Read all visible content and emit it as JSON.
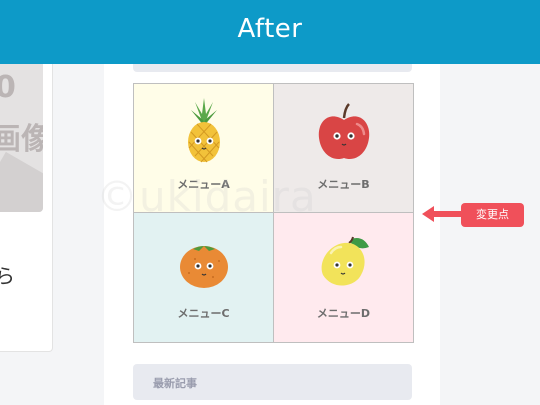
{
  "header": {
    "title": "After"
  },
  "left_column": {
    "thumb_zero": "0",
    "thumb_text": "画像",
    "partial_text": "ら"
  },
  "menu": {
    "items": [
      {
        "label": "メニューA",
        "icon": "pineapple-icon",
        "bg": "#fffde8"
      },
      {
        "label": "メニューB",
        "icon": "apple-icon",
        "bg": "#eeeae9"
      },
      {
        "label": "メニューC",
        "icon": "orange-icon",
        "bg": "#e2f2f2"
      },
      {
        "label": "メニューD",
        "icon": "lemon-icon",
        "bg": "#ffeaee"
      }
    ]
  },
  "watermark": "©ukidaira",
  "annotation": {
    "badge": "変更点",
    "color": "#f0505a"
  },
  "recent": {
    "title": "最新記事"
  },
  "colors": {
    "header": "#0d9ac8",
    "accent": "#f0505a"
  }
}
